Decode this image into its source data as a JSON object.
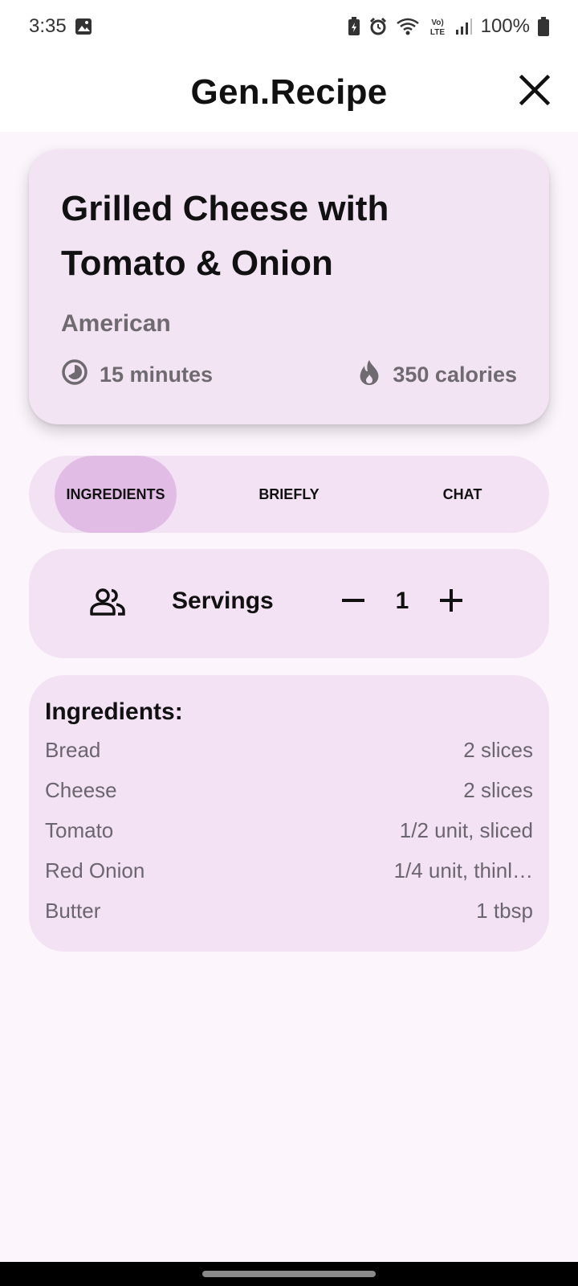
{
  "status_bar": {
    "time": "3:35",
    "battery": "100%",
    "icons": [
      "gallery-icon",
      "battery-saver-icon",
      "alarm-icon",
      "wifi-icon",
      "volte-icon",
      "signal-icon",
      "battery-icon"
    ]
  },
  "app_bar": {
    "title": "Gen.Recipe",
    "close_icon": "close-icon"
  },
  "recipe": {
    "title": "Grilled Cheese with Tomato & Onion",
    "cuisine": "American",
    "time": "15 minutes",
    "calories": "350 calories",
    "time_icon": "timer-icon",
    "calories_icon": "flame-icon"
  },
  "tabs": [
    {
      "label": "INGREDIENTS",
      "active": true
    },
    {
      "label": "BRIEFLY",
      "active": false
    },
    {
      "label": "CHAT",
      "active": false
    }
  ],
  "servings": {
    "label": "Servings",
    "count": "1",
    "icon": "people-icon"
  },
  "ingredients": {
    "heading": "Ingredients:",
    "items": [
      {
        "name": "Bread",
        "amount": "2 slices"
      },
      {
        "name": "Cheese",
        "amount": "2 slices"
      },
      {
        "name": "Tomato",
        "amount": "1/2 unit, sliced"
      },
      {
        "name": "Red Onion",
        "amount": "1/4 unit, thinl…"
      },
      {
        "name": "Butter",
        "amount": "1 tbsp"
      }
    ]
  },
  "colors": {
    "card_bg": "#f3e4f4",
    "tab_active": "#e1bde6",
    "page_bg": "#fcf5fc",
    "muted_text": "#6e6a70"
  }
}
